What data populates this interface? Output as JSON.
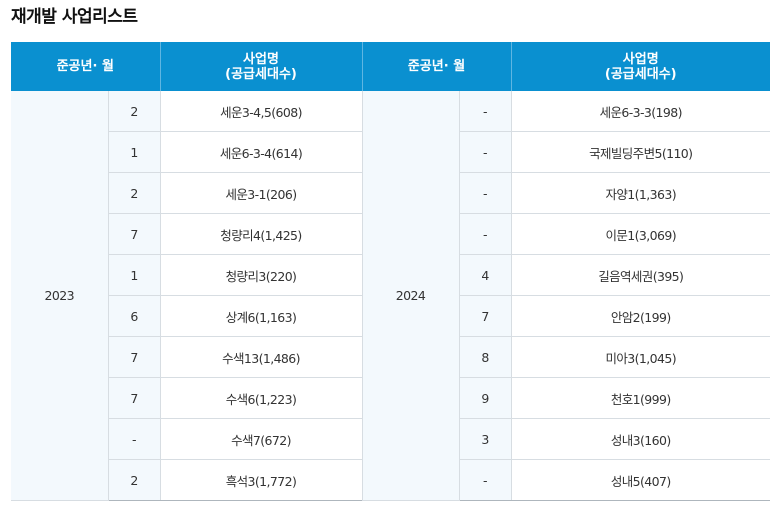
{
  "title": "재개발 사업리스트",
  "headers": {
    "date": "준공년· 월",
    "project_line1": "사업명",
    "project_line2": "(공급세대수)"
  },
  "groups": [
    {
      "year": "2023",
      "rows": [
        {
          "month": "2",
          "project": "세운3-4,5(608)"
        },
        {
          "month": "1",
          "project": "세운6-3-4(614)"
        },
        {
          "month": "2",
          "project": "세운3-1(206)"
        },
        {
          "month": "7",
          "project": "청량리4(1,425)"
        },
        {
          "month": "1",
          "project": "청량리3(220)"
        },
        {
          "month": "6",
          "project": "상계6(1,163)"
        },
        {
          "month": "7",
          "project": "수색13(1,486)"
        },
        {
          "month": "7",
          "project": "수색6(1,223)"
        },
        {
          "month": "-",
          "project": "수색7(672)"
        },
        {
          "month": "2",
          "project": "흑석3(1,772)"
        }
      ]
    },
    {
      "year": "2024",
      "rows": [
        {
          "month": "-",
          "project": "세운6-3-3(198)"
        },
        {
          "month": "-",
          "project": "국제빌딩주변5(110)"
        },
        {
          "month": "-",
          "project": "자양1(1,363)"
        },
        {
          "month": "-",
          "project": "이문1(3,069)"
        },
        {
          "month": "4",
          "project": "길음역세권(395)"
        },
        {
          "month": "7",
          "project": "안암2(199)"
        },
        {
          "month": "8",
          "project": "미아3(1,045)"
        },
        {
          "month": "9",
          "project": "천호1(999)"
        },
        {
          "month": "3",
          "project": "성내3(160)"
        },
        {
          "month": "-",
          "project": "성내5(407)"
        }
      ]
    }
  ]
}
